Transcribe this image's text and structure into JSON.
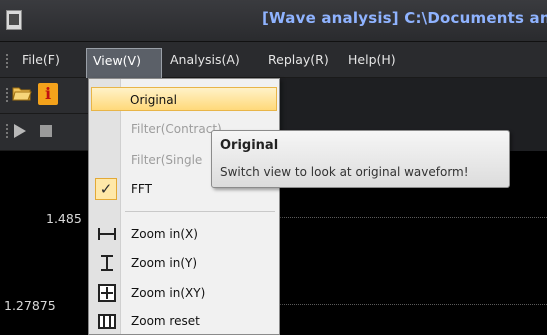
{
  "window": {
    "title": "[Wave analysis] C:\\Documents an"
  },
  "menubar": {
    "items": [
      {
        "label": "File(F)"
      },
      {
        "label": "View(V)"
      },
      {
        "label": "Analysis(A)"
      },
      {
        "label": "Replay(R)"
      },
      {
        "label": "Help(H)"
      }
    ],
    "active_index": 1
  },
  "toolbar": {
    "icons": [
      "open-folder-icon",
      "info-icon",
      "play-icon",
      "stop-icon"
    ],
    "info_glyph": "i"
  },
  "view_menu": {
    "items": [
      {
        "label": "Original",
        "state": "highlighted"
      },
      {
        "label": "Filter(Contract)",
        "state": "disabled"
      },
      {
        "label": "Filter(Single",
        "state": "disabled"
      },
      {
        "label": "FFT",
        "state": "checked",
        "check_glyph": "✓"
      },
      {
        "label": "Zoom in(X)",
        "icon": "zoom-x-icon"
      },
      {
        "label": "Zoom in(Y)",
        "icon": "zoom-y-icon"
      },
      {
        "label": "Zoom in(XY)",
        "icon": "zoom-xy-icon"
      },
      {
        "label": "Zoom reset",
        "icon": "zoom-reset-icon"
      }
    ]
  },
  "tooltip": {
    "title": "Original",
    "description": "Switch view to look at original waveform!"
  },
  "plot": {
    "y_labels": [
      "1.485",
      "1.27875"
    ]
  },
  "colors": {
    "title_text": "#8fb3ff",
    "highlight_bg": "#ffd97a",
    "check_bg": "#ffe8a8",
    "plot_bg": "#000000"
  }
}
